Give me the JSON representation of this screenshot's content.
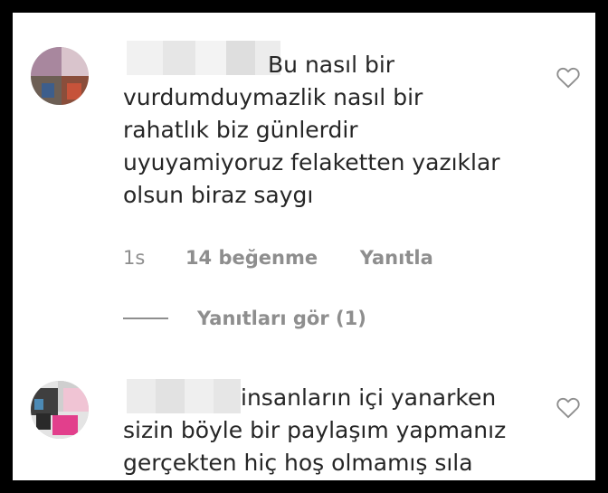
{
  "comments": [
    {
      "text": "Bu nasıl bir\nvurdumduymazlik nasıl bir\nrahatlık biz günlerdir\nuyuyamiyoruz felaketten yazıklar\nolsun biraz saygı",
      "time": "1s",
      "likes": "14 beğenme",
      "reply_label": "Yanıtla",
      "view_replies": "Yanıtları gör (1)"
    },
    {
      "text": "insanların içi yanarken\nsizin böyle bir paylaşım yapmanız\ngerçekten hiç hoş olmamış sıla"
    }
  ],
  "icons": {
    "like": "heart-outline-icon"
  },
  "colors": {
    "text": "#262626",
    "muted": "#8e8e8e",
    "frame": "#000000"
  }
}
